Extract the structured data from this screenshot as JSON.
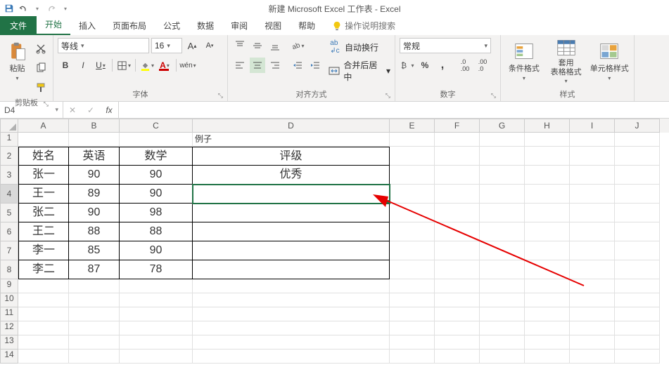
{
  "title": "新建 Microsoft Excel 工作表 - Excel",
  "qat": {
    "save": "save-icon",
    "undo": "undo-icon",
    "redo": "redo-icon"
  },
  "tabs": {
    "file": "文件",
    "home": "开始",
    "insert": "插入",
    "layout": "页面布局",
    "formulas": "公式",
    "data": "数据",
    "review": "审阅",
    "view": "视图",
    "help": "帮助",
    "tell_me": "操作说明搜索"
  },
  "ribbon": {
    "clipboard": {
      "label": "剪贴板",
      "paste": "粘贴"
    },
    "font": {
      "label": "字体",
      "name": "等线",
      "size": "16",
      "bold": "B",
      "italic": "I",
      "underline": "U"
    },
    "align": {
      "label": "对齐方式",
      "wrap": "自动换行",
      "merge": "合并后居中"
    },
    "number": {
      "label": "数字",
      "format": "常规"
    },
    "styles": {
      "label": "样式",
      "cond": "条件格式",
      "table": "套用\n表格格式",
      "cell": "单元格样式"
    }
  },
  "namebox": "D4",
  "formula": "",
  "columns": [
    "A",
    "B",
    "C",
    "D",
    "E",
    "F",
    "G",
    "H",
    "I",
    "J"
  ],
  "rows": [
    "1",
    "2",
    "3",
    "4",
    "5",
    "6",
    "7",
    "8",
    "9",
    "10",
    "11",
    "12",
    "13",
    "14"
  ],
  "sheet": {
    "D1": "例子",
    "A2": "姓名",
    "B2": "英语",
    "C2": "数学",
    "D2": "评级",
    "A3": "张一",
    "B3": "90",
    "C3": "90",
    "D3": "优秀",
    "A4": "王一",
    "B4": "89",
    "C4": "90",
    "A5": "张二",
    "B5": "90",
    "C5": "98",
    "A6": "王二",
    "B6": "88",
    "C6": "88",
    "A7": "李一",
    "B7": "85",
    "C7": "90",
    "A8": "李二",
    "B8": "87",
    "C8": "78"
  },
  "active_cell": "D4"
}
